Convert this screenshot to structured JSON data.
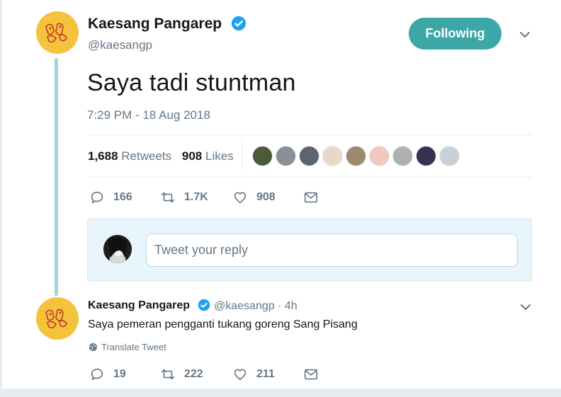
{
  "tweet": {
    "author_name": "Kaesang Pangarep",
    "author_handle": "@kaesangp",
    "follow_button": "Following",
    "text": "Saya tadi stuntman",
    "timestamp": "7:29 PM - 18 Aug 2018",
    "retweets_count": "1,688",
    "retweets_label": "Retweets",
    "likes_count": "908",
    "likes_label": "Likes",
    "likers": [
      "#4a5a3a",
      "#8a8f98",
      "#5c6470",
      "#e8d8c8",
      "#9b8a6a",
      "#f0c8c0",
      "#b0b0b0",
      "#3a3050",
      "#c8d0d8"
    ],
    "actions": {
      "replies": "166",
      "retweets": "1.7K",
      "likes": "908"
    }
  },
  "reply_box": {
    "placeholder": "Tweet your reply"
  },
  "reply": {
    "author_name": "Kaesang Pangarep",
    "handle_time": "@kaesangp · 4h",
    "text": "Saya pemeran pengganti tukang goreng Sang Pisang",
    "translate": "Translate Tweet",
    "actions": {
      "replies": "19",
      "retweets": "222",
      "likes": "211"
    }
  },
  "colors": {
    "accent": "#3ba7a6",
    "thread": "#9fd7d6",
    "verified": "#1da1f2",
    "avatar_bg": "#f5c33b"
  }
}
